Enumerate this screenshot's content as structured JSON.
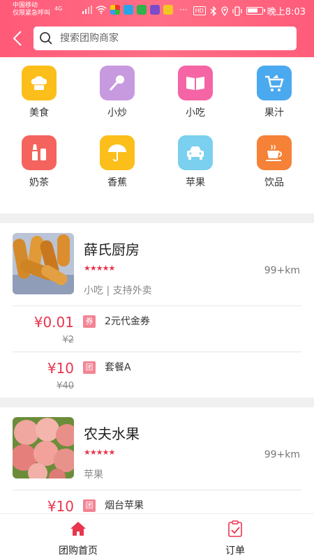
{
  "status_bar": {
    "carrier_line1": "中国移动",
    "carrier_line2": "仅限紧急呼叫",
    "network": "4G",
    "hd": "HD",
    "time": "晚上8:03",
    "more": "···"
  },
  "header": {
    "search_placeholder": "搜索团购商家"
  },
  "categories": [
    {
      "label": "美食",
      "icon": "chef-hat-icon",
      "color": "#fbbe1a"
    },
    {
      "label": "小炒",
      "icon": "spatula-icon",
      "color": "#c79ae0"
    },
    {
      "label": "小吃",
      "icon": "book-icon",
      "color": "#f565a5"
    },
    {
      "label": "果汁",
      "icon": "cart-icon",
      "color": "#4aa9ef"
    },
    {
      "label": "奶茶",
      "icon": "milk-tea-icon",
      "color": "#f5635e"
    },
    {
      "label": "香蕉",
      "icon": "umbrella-icon",
      "color": "#fbbe1a"
    },
    {
      "label": "苹果",
      "icon": "car-icon",
      "color": "#7ad0ee"
    },
    {
      "label": "饮品",
      "icon": "coffee-cup-icon",
      "color": "#f58237"
    }
  ],
  "shops": [
    {
      "name": "薛氏厨房",
      "rating": 5,
      "distance": "99+km",
      "tags": "小吃 | 支持外卖",
      "deals": [
        {
          "price": "¥0.01",
          "original": "¥2",
          "badge": "券",
          "name": "2元代金券"
        },
        {
          "price": "¥10",
          "original": "¥40",
          "badge": "团",
          "name": "套餐A"
        }
      ]
    },
    {
      "name": "农夫水果",
      "rating": 5,
      "distance": "99+km",
      "tags": "苹果",
      "deals": [
        {
          "price": "¥10",
          "badge": "团",
          "name": "烟台苹果"
        }
      ]
    }
  ],
  "bottom_nav": [
    {
      "label": "团购首页",
      "icon": "home-icon",
      "active": true,
      "color": "#e8354e"
    },
    {
      "label": "订单",
      "icon": "clipboard-icon",
      "active": false,
      "color": "#e8354e"
    }
  ],
  "colors": {
    "header": "#ff6480",
    "accent": "#e8354e",
    "badge": "#f38494"
  }
}
